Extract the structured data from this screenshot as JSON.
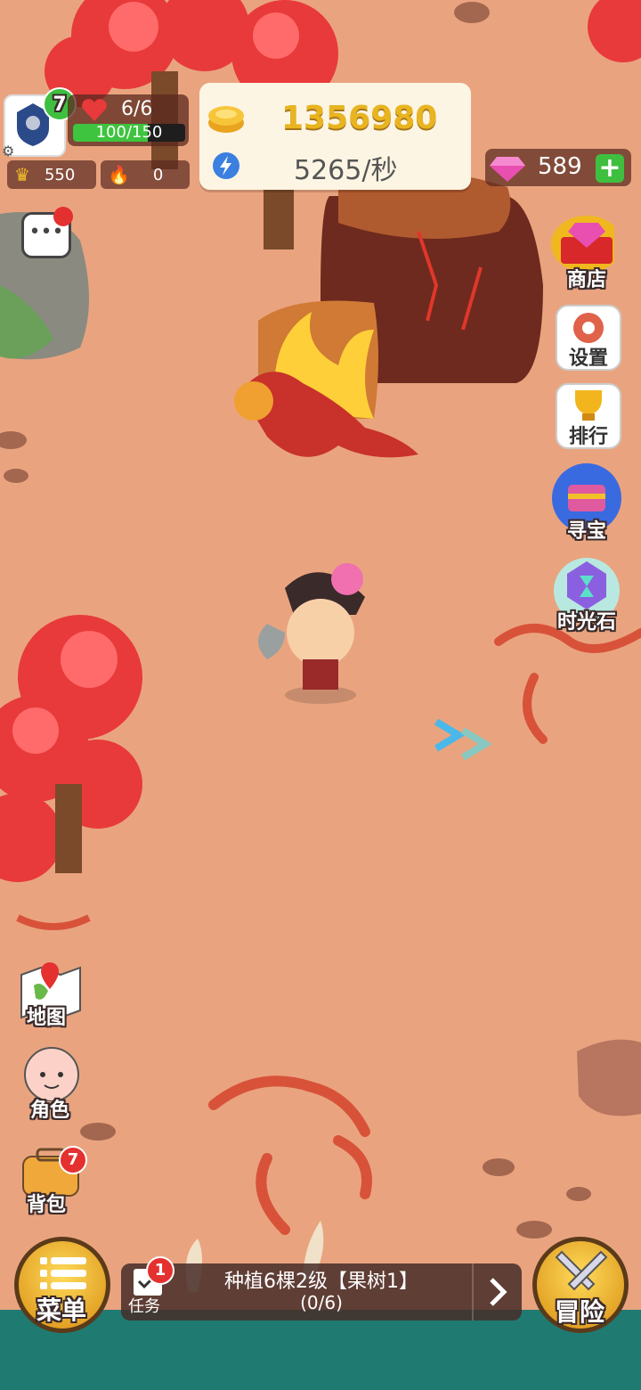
{
  "player": {
    "level": "7",
    "hearts": "6/6",
    "energy_text": "100/150",
    "energy_fraction": 0.667,
    "crowns": "550",
    "flames": "0"
  },
  "currency": {
    "coins": "1356980",
    "rate": "5265/秒",
    "gems": "589",
    "plus": "+"
  },
  "right_menu": {
    "shop": "商店",
    "settings": "设置",
    "ranking": "排行",
    "treasure": "寻宝",
    "timestone": "时光石"
  },
  "left_menu": {
    "map": "地图",
    "character": "角色",
    "bag": "背包",
    "bag_badge": "7"
  },
  "bottom": {
    "menu": "菜单",
    "task": "任务",
    "task_badge": "1",
    "quest_title": "种植6棵2级【果树1】",
    "quest_progress": "(0/6)",
    "adventure": "冒险"
  },
  "colors": {
    "ground": "#e9a47f",
    "coin_gold": "#e8b420",
    "accent_green": "#3fbf3f",
    "water": "#1f7a72"
  }
}
